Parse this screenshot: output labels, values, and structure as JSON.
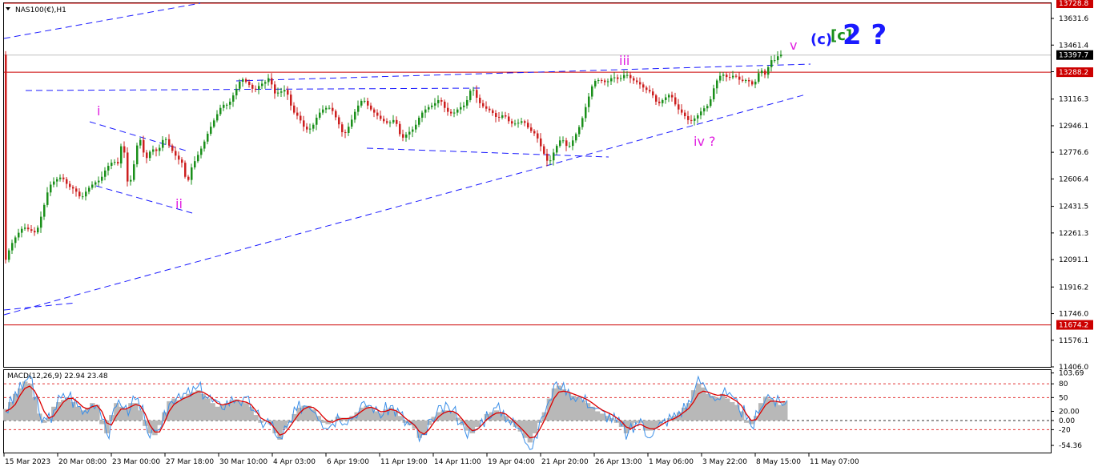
{
  "symbol_label": "NAS100(€),H1",
  "macd_label": "MACD(12,26,9) 22.94 23.48",
  "colors": {
    "bull": "#1a8f1a",
    "bear": "#cc1f1f",
    "trend": "#1a1aff",
    "hline": "#cc0000",
    "magenta": "#e020e0",
    "blue_label": "#1a1aff",
    "green_label": "#1a8f1a",
    "macd_signal": "#dd0000",
    "macd_line": "#3b8fe8",
    "macd_hist": "#b8b8b8"
  },
  "chart_data": [
    {
      "type": "candlestick",
      "title": "NAS100(€),H1",
      "ylim": [
        11406.0,
        13728.8
      ],
      "price_ticks": [
        "13631.6",
        "13461.4",
        "13291.2",
        "13116.3",
        "12946.1",
        "12776.6",
        "12606.4",
        "12431.5",
        "12261.3",
        "12091.1",
        "11916.2",
        "11746.0",
        "11576.1",
        "11406.0"
      ],
      "price_labels": [
        {
          "text": "13728.8",
          "value": 13728.8
        },
        {
          "text": "13397.7",
          "value": 13397.7
        },
        {
          "text": "13288.2",
          "value": 13288.2
        },
        {
          "text": "11674.2",
          "value": 11674.2
        }
      ],
      "horizontal_lines": [
        13728.8,
        13288.2,
        11674.2
      ],
      "current_price": 13397.7,
      "time_labels": [
        "15 Mar 2023",
        "20 Mar 08:00",
        "23 Mar 00:00",
        "27 Mar 18:00",
        "30 Mar 10:00",
        "4 Apr 03:00",
        "6 Apr 19:00",
        "11 Apr 19:00",
        "14 Apr 11:00",
        "19 Apr 04:00",
        "21 Apr 20:00",
        "26 Apr 13:00",
        "1 May 06:00",
        "3 May 22:00",
        "8 May 15:00",
        "11 May 07:00"
      ],
      "path_points": [
        [
          0,
          12060
        ],
        [
          2,
          12180
        ],
        [
          4,
          12250
        ],
        [
          6,
          12300
        ],
        [
          8,
          12280
        ],
        [
          10,
          12260
        ],
        [
          12,
          12400
        ],
        [
          14,
          12560
        ],
        [
          16,
          12600
        ],
        [
          18,
          12620
        ],
        [
          20,
          12560
        ],
        [
          22,
          12540
        ],
        [
          24,
          12480
        ],
        [
          26,
          12540
        ],
        [
          28,
          12580
        ],
        [
          30,
          12600
        ],
        [
          32,
          12680
        ],
        [
          34,
          12720
        ],
        [
          36,
          12700
        ],
        [
          37,
          12930
        ],
        [
          38,
          12620
        ],
        [
          39,
          12560
        ],
        [
          40,
          12640
        ],
        [
          42,
          12880
        ],
        [
          43,
          12830
        ],
        [
          44,
          12720
        ],
        [
          46,
          12800
        ],
        [
          48,
          12780
        ],
        [
          50,
          12880
        ],
        [
          52,
          12800
        ],
        [
          54,
          12740
        ],
        [
          56,
          12700
        ],
        [
          57,
          12540
        ],
        [
          58,
          12660
        ],
        [
          60,
          12740
        ],
        [
          62,
          12820
        ],
        [
          64,
          12920
        ],
        [
          66,
          13000
        ],
        [
          68,
          13080
        ],
        [
          70,
          13080
        ],
        [
          72,
          13160
        ],
        [
          74,
          13250
        ],
        [
          76,
          13220
        ],
        [
          78,
          13170
        ],
        [
          80,
          13210
        ],
        [
          82,
          13230
        ],
        [
          83,
          13270
        ],
        [
          84,
          13150
        ],
        [
          86,
          13160
        ],
        [
          88,
          13180
        ],
        [
          90,
          13040
        ],
        [
          92,
          13000
        ],
        [
          94,
          12920
        ],
        [
          96,
          12930
        ],
        [
          98,
          13020
        ],
        [
          100,
          13060
        ],
        [
          102,
          13060
        ],
        [
          104,
          12980
        ],
        [
          106,
          12880
        ],
        [
          108,
          12960
        ],
        [
          110,
          13060
        ],
        [
          112,
          13120
        ],
        [
          114,
          13060
        ],
        [
          116,
          13020
        ],
        [
          118,
          12980
        ],
        [
          120,
          12960
        ],
        [
          122,
          12990
        ],
        [
          124,
          12860
        ],
        [
          126,
          12900
        ],
        [
          128,
          12930
        ],
        [
          130,
          13020
        ],
        [
          132,
          13060
        ],
        [
          134,
          13080
        ],
        [
          136,
          13120
        ],
        [
          138,
          13040
        ],
        [
          140,
          13020
        ],
        [
          142,
          13060
        ],
        [
          144,
          13080
        ],
        [
          146,
          13200
        ],
        [
          148,
          13100
        ],
        [
          150,
          13060
        ],
        [
          152,
          13040
        ],
        [
          154,
          12990
        ],
        [
          156,
          13020
        ],
        [
          158,
          12960
        ],
        [
          160,
          12960
        ],
        [
          162,
          12980
        ],
        [
          164,
          12920
        ],
        [
          166,
          12890
        ],
        [
          168,
          12790
        ],
        [
          170,
          12700
        ],
        [
          172,
          12800
        ],
        [
          174,
          12870
        ],
        [
          176,
          12800
        ],
        [
          178,
          12870
        ],
        [
          180,
          12960
        ],
        [
          182,
          13100
        ],
        [
          184,
          13230
        ],
        [
          186,
          13240
        ],
        [
          188,
          13220
        ],
        [
          190,
          13260
        ],
        [
          192,
          13240
        ],
        [
          194,
          13280
        ],
        [
          196,
          13240
        ],
        [
          198,
          13220
        ],
        [
          200,
          13180
        ],
        [
          202,
          13160
        ],
        [
          204,
          13080
        ],
        [
          206,
          13120
        ],
        [
          208,
          13150
        ],
        [
          210,
          13060
        ],
        [
          212,
          13020
        ],
        [
          214,
          12970
        ],
        [
          216,
          13000
        ],
        [
          218,
          13050
        ],
        [
          220,
          13080
        ],
        [
          222,
          13220
        ],
        [
          224,
          13280
        ],
        [
          226,
          13250
        ],
        [
          228,
          13270
        ],
        [
          230,
          13230
        ],
        [
          232,
          13240
        ],
        [
          234,
          13200
        ],
        [
          236,
          13310
        ],
        [
          238,
          13260
        ],
        [
          239,
          13380
        ],
        [
          240,
          13350
        ],
        [
          241,
          13380
        ],
        [
          242,
          13400
        ]
      ],
      "labels": [
        {
          "text": "i",
          "color": "magenta",
          "size": "small"
        },
        {
          "text": "ii",
          "color": "magenta",
          "size": "small"
        },
        {
          "text": "iii",
          "color": "magenta",
          "size": "small"
        },
        {
          "text": "iv ?",
          "color": "magenta",
          "size": "small"
        },
        {
          "text": "v",
          "color": "magenta",
          "size": "small"
        },
        {
          "text": "(c)",
          "color": "blue_label",
          "size": "medium"
        },
        {
          "text": "[c]",
          "color": "green_label",
          "size": "medium"
        },
        {
          "text": "2 ?",
          "color": "blue_label",
          "size": "large"
        }
      ]
    },
    {
      "type": "line",
      "title": "MACD(12,26,9) 22.94 23.48",
      "ylim": [
        -70,
        110
      ],
      "value_ticks": [
        "103.69",
        "80",
        "50",
        "20.00",
        "0.00",
        "-20",
        "-54.36"
      ],
      "dotted_levels": [
        80,
        50,
        0,
        -20
      ],
      "series": [
        {
          "name": "MACD",
          "values": [
            25,
            40,
            58,
            70,
            90,
            85,
            50,
            10,
            -5,
            5,
            30,
            45,
            50,
            55,
            40,
            30,
            20,
            30,
            40,
            35,
            -10,
            -30,
            15,
            40,
            30,
            25,
            40,
            40,
            20,
            -15,
            -30,
            -35,
            -10,
            20,
            45,
            50,
            45,
            55,
            60,
            65,
            70,
            60,
            50,
            40,
            30,
            35,
            40,
            45,
            50,
            40,
            40,
            30,
            10,
            -5,
            0,
            -10,
            -30,
            -45,
            -20,
            -5,
            15,
            30,
            35,
            35,
            25,
            10,
            -5,
            -10,
            0,
            10,
            5,
            5,
            10,
            20,
            30,
            35,
            30,
            20,
            15,
            25,
            30,
            20,
            10,
            -5,
            -10,
            -20,
            -40,
            -35,
            -10,
            10,
            20,
            25,
            25,
            20,
            5,
            -10,
            -25,
            -30,
            -15,
            0,
            15,
            20,
            25,
            20,
            10,
            -5,
            -15,
            -25,
            -40,
            -50,
            -30,
            -5,
            20,
            50,
            75,
            80,
            70,
            60,
            55,
            50,
            45,
            40,
            30,
            20,
            15,
            10,
            5,
            -5,
            -15,
            -30,
            -20,
            -5,
            -5,
            -25,
            -25,
            -20,
            -10,
            0,
            5,
            10,
            20,
            30,
            40,
            70,
            85,
            75,
            60,
            55,
            50,
            60,
            50,
            40,
            35,
            20,
            -5,
            -10,
            10,
            40,
            55,
            50,
            40,
            35,
            45
          ]
        },
        {
          "name": "Signal",
          "values": [
            20,
            25,
            35,
            55,
            70,
            75,
            65,
            45,
            20,
            5,
            10,
            25,
            40,
            48,
            48,
            40,
            30,
            25,
            30,
            33,
            20,
            -5,
            -10,
            10,
            25,
            25,
            30,
            35,
            32,
            15,
            -10,
            -25,
            -25,
            -5,
            20,
            35,
            42,
            48,
            52,
            58,
            63,
            62,
            56,
            48,
            38,
            34,
            36,
            40,
            44,
            42,
            40,
            35,
            22,
            6,
            0,
            -5,
            -18,
            -32,
            -28,
            -15,
            0,
            15,
            25,
            30,
            28,
            20,
            8,
            -2,
            -4,
            2,
            4,
            4,
            6,
            12,
            20,
            27,
            29,
            25,
            19,
            20,
            24,
            22,
            16,
            6,
            -2,
            -10,
            -24,
            -30,
            -20,
            -5,
            8,
            16,
            20,
            20,
            14,
            2,
            -12,
            -22,
            -20,
            -10,
            2,
            10,
            16,
            17,
            14,
            5,
            -5,
            -15,
            -26,
            -38,
            -36,
            -20,
            0,
            24,
            48,
            62,
            64,
            62,
            58,
            54,
            50,
            45,
            38,
            30,
            23,
            18,
            13,
            6,
            -2,
            -14,
            -18,
            -12,
            -8,
            -14,
            -18,
            -18,
            -12,
            -5,
            0,
            4,
            10,
            18,
            26,
            40,
            58,
            64,
            62,
            58,
            55,
            56,
            54,
            48,
            42,
            32,
            14,
            0,
            2,
            18,
            34,
            42,
            42,
            40,
            41
          ]
        },
        {
          "name": "Histogram",
          "values": [
            25,
            40,
            58,
            70,
            85,
            80,
            50,
            15,
            -5,
            5,
            30,
            40,
            45,
            50,
            40,
            30,
            22,
            28,
            38,
            34,
            -8,
            -28,
            12,
            38,
            30,
            25,
            38,
            38,
            22,
            -12,
            -28,
            -32,
            -10,
            18,
            42,
            48,
            44,
            52,
            58,
            62,
            66,
            58,
            48,
            38,
            30,
            34,
            38,
            44,
            46,
            40,
            38,
            30,
            12,
            -5,
            0,
            -8,
            -28,
            -42,
            -18,
            -5,
            14,
            28,
            32,
            32,
            24,
            10,
            -5,
            -8,
            0,
            8,
            6,
            6,
            10,
            18,
            28,
            32,
            28,
            20,
            16,
            24,
            28,
            20,
            10,
            -5,
            -10,
            -18,
            -38,
            -32,
            -10,
            8,
            18,
            22,
            22,
            18,
            6,
            -10,
            -22,
            -28,
            -14,
            0,
            14,
            18,
            22,
            18,
            10,
            -5,
            -14,
            -24,
            -38,
            -48,
            -28,
            -5,
            18,
            48,
            70,
            76,
            68,
            60,
            54,
            50,
            44,
            38,
            30,
            20,
            15,
            10,
            5,
            -5,
            -14,
            -28,
            -18,
            -5,
            -5,
            -22,
            -22,
            -18,
            -10,
            0,
            5,
            10,
            18,
            28,
            38,
            66,
            80,
            72,
            58,
            54,
            50,
            58,
            48,
            40,
            34,
            20,
            -5,
            -8,
            10,
            38,
            52,
            48,
            40,
            34,
            42
          ]
        }
      ]
    }
  ]
}
